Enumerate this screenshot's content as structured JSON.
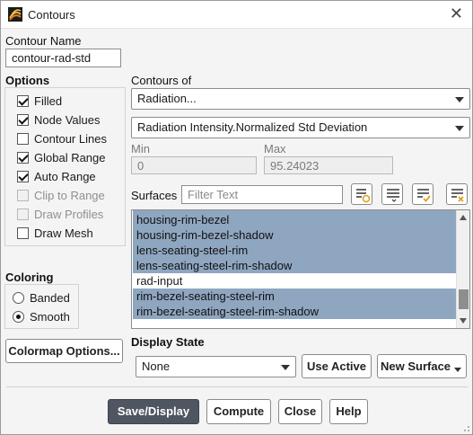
{
  "window": {
    "title": "Contours",
    "close_glyph": "✕",
    "app_icon": "fluent-contours-icon"
  },
  "contour_name": {
    "label": "Contour Name",
    "value": "contour-rad-std"
  },
  "options": {
    "heading": "Options",
    "items": [
      {
        "label": "Filled",
        "checked": true,
        "enabled": true
      },
      {
        "label": "Node Values",
        "checked": true,
        "enabled": true
      },
      {
        "label": "Contour Lines",
        "checked": false,
        "enabled": true
      },
      {
        "label": "Global Range",
        "checked": true,
        "enabled": true
      },
      {
        "label": "Auto Range",
        "checked": true,
        "enabled": true
      },
      {
        "label": "Clip to Range",
        "checked": false,
        "enabled": false
      },
      {
        "label": "Draw Profiles",
        "checked": false,
        "enabled": false
      },
      {
        "label": "Draw Mesh",
        "checked": false,
        "enabled": true
      }
    ]
  },
  "coloring": {
    "heading": "Coloring",
    "options": [
      {
        "label": "Banded",
        "selected": false
      },
      {
        "label": "Smooth",
        "selected": true
      }
    ]
  },
  "colormap_button": "Colormap Options...",
  "contours_of": {
    "label": "Contours of",
    "category": "Radiation...",
    "quantity": "Radiation Intensity.Normalized Std Deviation"
  },
  "range": {
    "min_label": "Min",
    "min_value": "0",
    "max_label": "Max",
    "max_value": "95.24023"
  },
  "surfaces": {
    "label": "Surfaces",
    "filter_placeholder": "Filter Text",
    "toolbar_icons": [
      "new-surface-icon",
      "select-all-icon",
      "select-checked-icon",
      "deselect-all-icon"
    ],
    "items": [
      {
        "label": "",
        "selected": true,
        "partial": true
      },
      {
        "label": "housing-rim-bezel",
        "selected": true
      },
      {
        "label": "housing-rim-bezel-shadow",
        "selected": true
      },
      {
        "label": "lens-seating-steel-rim",
        "selected": true
      },
      {
        "label": "lens-seating-steel-rim-shadow",
        "selected": true
      },
      {
        "label": "rad-input",
        "selected": false
      },
      {
        "label": "rim-bezel-seating-steel-rim",
        "selected": true
      },
      {
        "label": "rim-bezel-seating-steel-rim-shadow",
        "selected": true
      }
    ]
  },
  "display_state": {
    "label": "Display State",
    "value": "None",
    "use_active": "Use Active",
    "new_surface": "New Surface"
  },
  "footer": {
    "save_display": "Save/Display",
    "compute": "Compute",
    "close": "Close",
    "help": "Help"
  },
  "colors": {
    "selection": "#8fa6c0",
    "primary_button": "#4f5661",
    "window_bg": "#f4f4f4"
  }
}
